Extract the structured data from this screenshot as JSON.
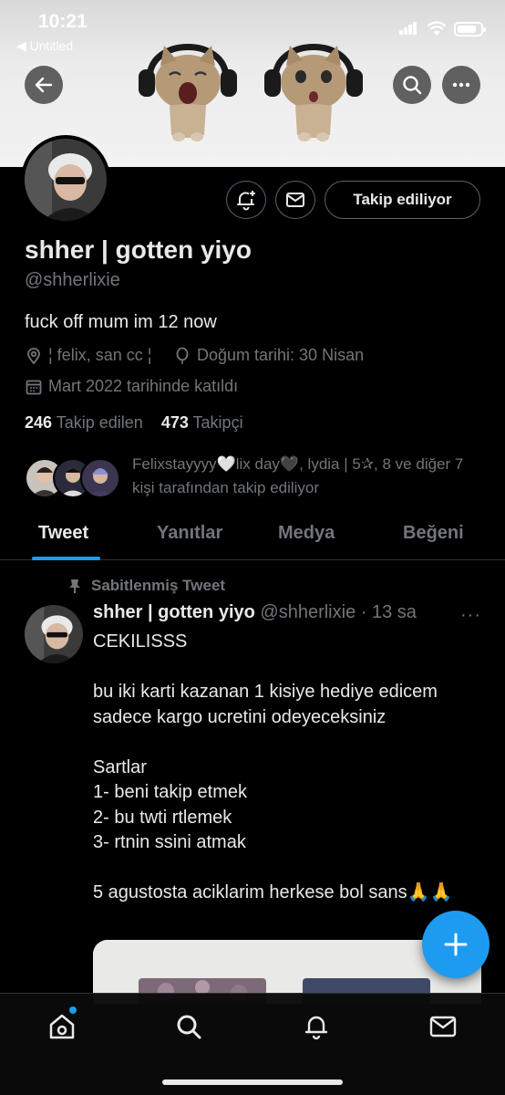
{
  "status_bar": {
    "time": "10:21",
    "back_app": "◀ Untitled"
  },
  "profile": {
    "display_name": "shher | gotten yiyo",
    "handle": "@shherlixie",
    "bio": "fuck off mum im 12 now",
    "location": "¦ felix, san cc ¦",
    "birthday": "Doğum tarihi: 30 Nisan",
    "joined": "Mart 2022 tarihinde katıldı",
    "following_count": "246",
    "following_label": "Takip edilen",
    "followers_count": "473",
    "followers_label": "Takipçi",
    "followed_by": "Felixstayyyy🤍lix day🖤, lydia | 5✰, 8 ve diğer 7 kişi tarafından takip ediliyor",
    "follow_button": "Takip ediliyor"
  },
  "tabs": [
    {
      "label": "Tweet",
      "active": true
    },
    {
      "label": "Yanıtlar",
      "active": false
    },
    {
      "label": "Medya",
      "active": false
    },
    {
      "label": "Beğeni",
      "active": false
    }
  ],
  "pinned_tweet": {
    "pinned_label": "Sabitlenmiş Tweet",
    "author_name": "shher | gotten yiyo",
    "author_handle": "@shherlixie · 13 sa",
    "more": "···",
    "text": "CEKILISSS\n\nbu iki karti kazanan 1 kisiye hediye edicem sadece kargo ucretini odeyeceksiniz\n\nSartlar\n1- beni takip etmek\n2- bu twti rtlemek\n3- rtnin ssini atmak\n\n5 agustosta aciklarim herkese bol sans🙏🙏"
  },
  "fab": {
    "label": "+"
  },
  "colors": {
    "accent": "#1d9bf0",
    "background": "#000000",
    "secondary_text": "#71767b"
  },
  "icons": [
    "back-arrow-icon",
    "search-icon",
    "more-icon",
    "notification-bell-plus-icon",
    "mail-icon",
    "location-pin-icon",
    "balloon-icon",
    "calendar-icon",
    "pin-icon",
    "home-icon",
    "search-icon",
    "bell-icon",
    "mail-icon"
  ]
}
